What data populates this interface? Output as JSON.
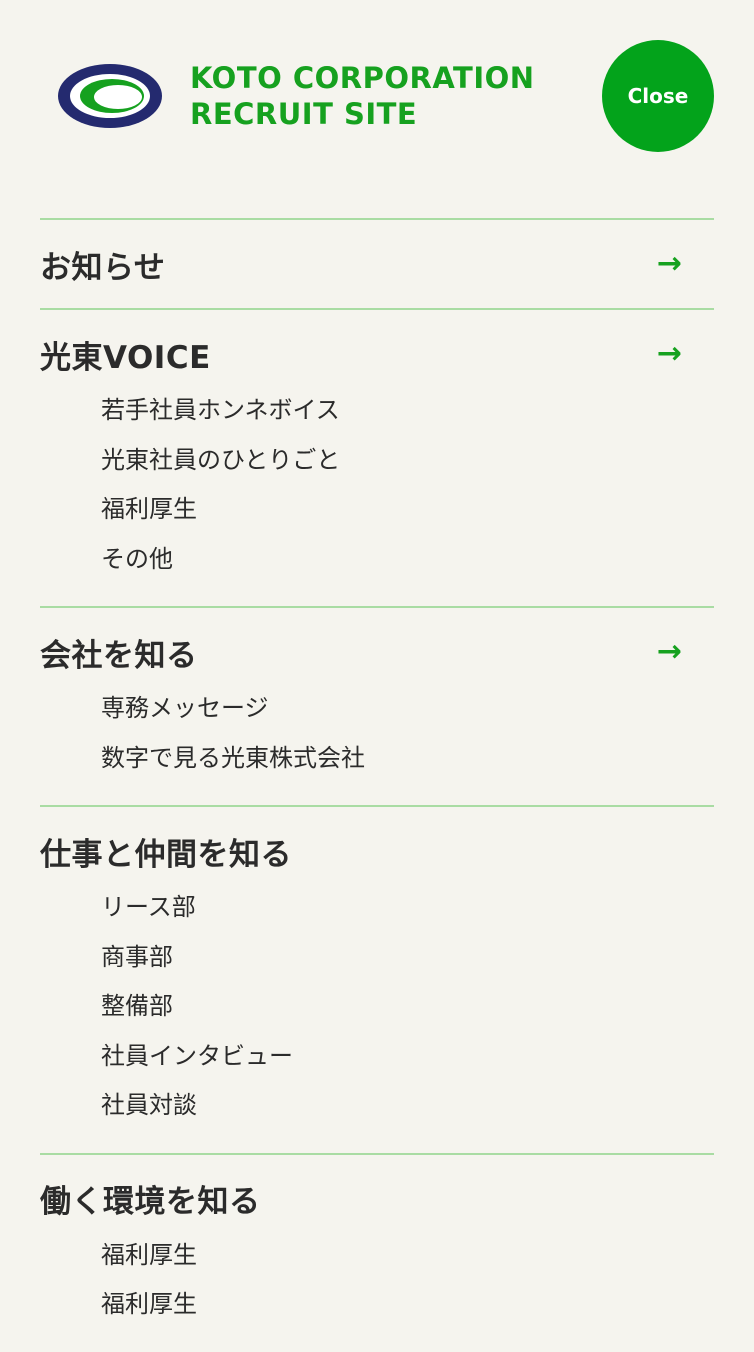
{
  "brand": {
    "title_line1": "KOTO CORPORATION",
    "title_line2": "RECRUIT SITE",
    "logo_icon": "koto-logo-icon",
    "accent_color": "#03a31b",
    "logo_navy": "#242a6f"
  },
  "header": {
    "close_label": "Close"
  },
  "nav": {
    "sections": [
      {
        "title": "お知らせ",
        "arrow": "→",
        "items": []
      },
      {
        "title": "光東VOICE",
        "arrow": "→",
        "items": [
          "若手社員ホンネボイス",
          "光東社員のひとりごと",
          "福利厚生",
          "その他"
        ]
      },
      {
        "title": "会社を知る",
        "arrow": "→",
        "items": [
          "専務メッセージ",
          "数字で見る光東株式会社"
        ]
      },
      {
        "title": "仕事と仲間を知る",
        "items": [
          "リース部",
          "商事部",
          "整備部",
          "社員インタビュー",
          "社員対談"
        ]
      },
      {
        "title": "働く環境を知る",
        "items": [
          "福利厚生",
          "福利厚生"
        ]
      }
    ]
  }
}
